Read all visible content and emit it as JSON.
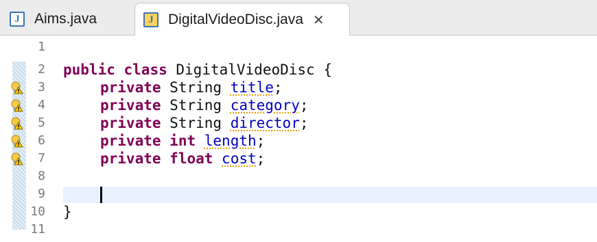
{
  "tabs": [
    {
      "label": "Aims.java",
      "active": false
    },
    {
      "label": "DigitalVideoDisc.java",
      "active": true,
      "close_glyph": "✕"
    }
  ],
  "editor": {
    "lines": [
      {
        "num": "1"
      },
      {
        "num": "2",
        "tokens": [
          [
            "kw",
            "public"
          ],
          [
            "",
            ""
          ],
          [
            "kw",
            "class"
          ],
          [
            "",
            ""
          ],
          [
            "",
            "DigitalVideoDisc {"
          ]
        ]
      },
      {
        "num": "3",
        "warning": true,
        "tokens": [
          [
            "kw",
            "private"
          ],
          [
            "",
            "String"
          ],
          [
            "fld",
            "title"
          ],
          [
            "",
            ";"
          ]
        ]
      },
      {
        "num": "4",
        "warning": true,
        "tokens": [
          [
            "kw",
            "private"
          ],
          [
            "",
            "String"
          ],
          [
            "fld",
            "category"
          ],
          [
            "",
            ";"
          ]
        ]
      },
      {
        "num": "5",
        "warning": true,
        "tokens": [
          [
            "kw",
            "private"
          ],
          [
            "",
            "String"
          ],
          [
            "fld",
            "director"
          ],
          [
            "",
            ";"
          ]
        ]
      },
      {
        "num": "6",
        "warning": true,
        "tokens": [
          [
            "kw",
            "private"
          ],
          [
            "kw",
            "int"
          ],
          [
            "fld",
            "length"
          ],
          [
            "",
            ";"
          ]
        ]
      },
      {
        "num": "7",
        "warning": true,
        "tokens": [
          [
            "kw",
            "private"
          ],
          [
            "kw",
            "float"
          ],
          [
            "fld",
            "cost"
          ],
          [
            "",
            ";"
          ]
        ]
      },
      {
        "num": "8"
      },
      {
        "num": "9",
        "current": true
      },
      {
        "num": "10",
        "tokens": [
          [
            "",
            "}"
          ]
        ]
      },
      {
        "num": "11"
      }
    ],
    "line2": {
      "kw1": "public",
      "kw2": "class",
      "rest": "DigitalVideoDisc {"
    },
    "line3": {
      "kw": "private",
      "type": "String",
      "field": "title"
    },
    "line4": {
      "kw": "private",
      "type": "String",
      "field": "category"
    },
    "line5": {
      "kw": "private",
      "type": "String",
      "field": "director"
    },
    "line6": {
      "kw": "private",
      "type": "int",
      "field": "length"
    },
    "line7": {
      "kw": "private",
      "type": "float",
      "field": "cost"
    },
    "line10": {
      "brace": "}"
    },
    "semicolon": ";",
    "icons": {
      "file": "java-file-icon",
      "warning": "warning-bulb-icon",
      "close": "close-icon"
    },
    "colors": {
      "keyword": "#7f0055",
      "field": "#0000c0",
      "current_line": "#e8f2fe"
    }
  }
}
